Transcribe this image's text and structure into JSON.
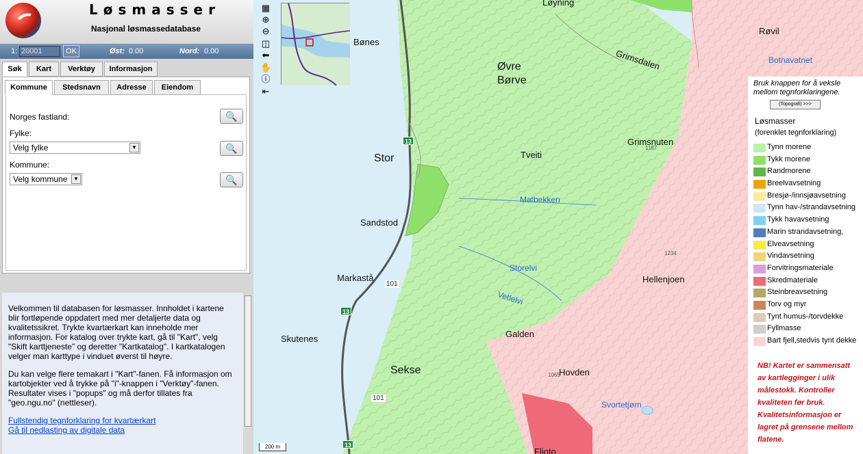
{
  "header": {
    "title": "Løsmasser",
    "subtitle": "Nasjonal løsmassedatabase"
  },
  "coordbar": {
    "scale_prefix": "1:",
    "scale_value": "20001",
    "ok_label": "OK",
    "east_label": "Øst:",
    "east_value": "0.00",
    "north_label": "Nord:",
    "north_value": "0.00"
  },
  "main_tabs": [
    "Søk",
    "Kart",
    "Verktøy",
    "Informasjon"
  ],
  "search_tabs": [
    "Kommune",
    "Stedsnavn",
    "Adresse",
    "Eiendom"
  ],
  "search_form": {
    "mainland_label": "Norges fastland:",
    "county_label": "Fylke:",
    "county_value": "Velg fylke",
    "municipality_label": "Kommune:",
    "municipality_value": "Velg kommune"
  },
  "info": {
    "p1": "Velkommen til databasen for løsmasser. Innholdet i kartene blir fortløpende oppdatert med mer detaljerte data og kvalitetssikret. Trykte kvartærkart kan inneholde mer informasjon. For katalog over trykte kart, gå til \"Kart\", velg \"Skift karttjeneste\" og deretter \"Kartkatalog\". I kartkatalogen velger man karttype i vinduet øverst til høyre.",
    "p2": "Du kan velge flere temakart i \"Kart\"-fanen. Få informasjon om kartobjekter ved å trykke på \"i\"-knappen i \"Verktøy\"-fanen. Resultater vises i \"popups\" og må derfor tillates fra \"geo.ngu.no\" (nettleser).",
    "link1": "Fullstendig tegnforklaring for kvartærkart",
    "link2": "Gå til nedlasting av digitale data"
  },
  "map": {
    "places": [
      "Løyning",
      "Bønes",
      "Øvre",
      "Børve",
      "Grimsdalen",
      "Røvil",
      "Stor",
      "Tveiti",
      "Grimsnuten",
      "Sandstod",
      "Markastå",
      "Hellenjoen",
      "Skutenes",
      "Galden",
      "Sekse",
      "Hovden",
      "Fljoto"
    ],
    "waters": [
      "Botnavatnet",
      "Matbekken",
      "Storelvi",
      "Vetlelvi",
      "Svortetjørn"
    ],
    "roads": [
      "13",
      "101"
    ],
    "elevations": [
      "1187",
      "1234",
      "1065"
    ],
    "scale_bar": "200 m"
  },
  "legend": {
    "hint": "Bruk knappen for å veksle mellom tegnforklaringene.",
    "toggle_button": "(Topografi) >>>",
    "title": "Løsmasser",
    "subtitle": "(forenklet tegnforklaring)",
    "items": [
      {
        "label": "Tynn morene",
        "color": "#b9f2a6"
      },
      {
        "label": "Tykk morene",
        "color": "#8fe06a"
      },
      {
        "label": "Randmorene",
        "color": "#5fb84a"
      },
      {
        "label": "Breelvavsetning",
        "color": "#f2a200"
      },
      {
        "label": "Bresjø-/innsjøavsetning",
        "color": "#f8eca0"
      },
      {
        "label": "Tynn hav-/strandavsetning",
        "color": "#d2e6f4"
      },
      {
        "label": "Tykk havavsetning",
        "color": "#7fd2ef"
      },
      {
        "label": "Marin strandavsetning,",
        "color": "#4f7ec0"
      },
      {
        "label": "Elveavsetning",
        "color": "#fde84a"
      },
      {
        "label": "Vindavsetning",
        "color": "#f3d37a"
      },
      {
        "label": "Forvitringsmateriale",
        "color": "#d9a0d8"
      },
      {
        "label": "Skredmateriale",
        "color": "#ee6a78"
      },
      {
        "label": "Steinbreavsetning",
        "color": "#b3a86a"
      },
      {
        "label": "Torv og myr",
        "color": "#c8865a"
      },
      {
        "label": "Tynt humus-/torvdekke",
        "color": "#dccbb8"
      },
      {
        "label": "Fyllmasse",
        "color": "#cfcfcf"
      },
      {
        "label": "Bart fjell,stedvis tynt dekke",
        "color": "#f9d3d3"
      }
    ],
    "notice": "NB! Kartet er sammensatt av kartlegginger i ulik målestokk. Kontroller kvaliteten før bruk. Kvalitetsinformasjon er lagret på grensene mellom flatene."
  }
}
